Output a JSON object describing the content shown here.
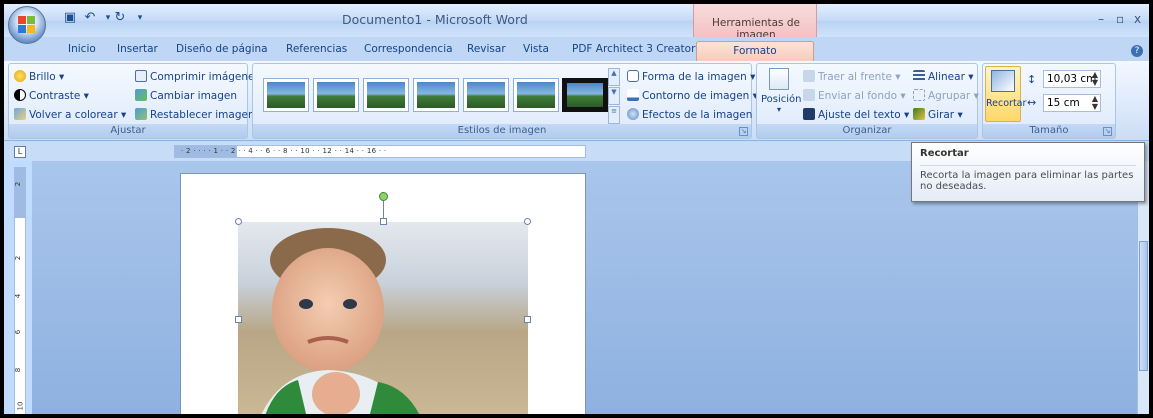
{
  "window": {
    "title": "Documento1 - Microsoft Word",
    "contextual_tab_header": "Herramientas de imagen",
    "controls": {
      "minimize": "–",
      "restore": "▫",
      "close": "x"
    }
  },
  "qat": {
    "save_icon": "save-icon",
    "undo_icon": "undo-icon",
    "redo_icon": "redo-icon"
  },
  "tabs": [
    "Inicio",
    "Insertar",
    "Diseño de página",
    "Referencias",
    "Correspondencia",
    "Revisar",
    "Vista",
    "PDF Architect 3 Creator"
  ],
  "active_tab": "Formato",
  "ribbon": {
    "ajustar": {
      "label": "Ajustar",
      "brillo": "Brillo",
      "contraste": "Contraste",
      "volver_colorear": "Volver a colorear",
      "comprimir": "Comprimir imágenes",
      "cambiar": "Cambiar imagen",
      "restablecer": "Restablecer imagen"
    },
    "estilos": {
      "label": "Estilos de imagen",
      "forma": "Forma de la imagen",
      "contorno": "Contorno de imagen",
      "efectos": "Efectos de la imagen"
    },
    "organizar": {
      "label": "Organizar",
      "posicion": "Posición",
      "traer": "Traer al frente",
      "enviar": "Enviar al fondo",
      "ajuste_texto": "Ajuste del texto",
      "alinear": "Alinear",
      "agrupar": "Agrupar",
      "girar": "Girar"
    },
    "tamano": {
      "label": "Tamaño",
      "recortar": "Recortar",
      "height": "10,03 cm",
      "width": "15 cm"
    }
  },
  "ruler": {
    "marks": "· 2 · · ·  · 1 ·  · 2 ·  · 4 ·  · 6 ·  · 8 ·  · 10 ·  · 12 ·  · 14 ·  · 16 ·  ·"
  },
  "vruler": [
    "2",
    "2",
    "4",
    "6",
    "8",
    "10"
  ],
  "tooltip": {
    "title": "Recortar",
    "body": "Recorta la imagen para eliminar las partes no deseadas."
  },
  "colors": {
    "accent": "#15428b",
    "contextual": "#f6c9b7"
  }
}
